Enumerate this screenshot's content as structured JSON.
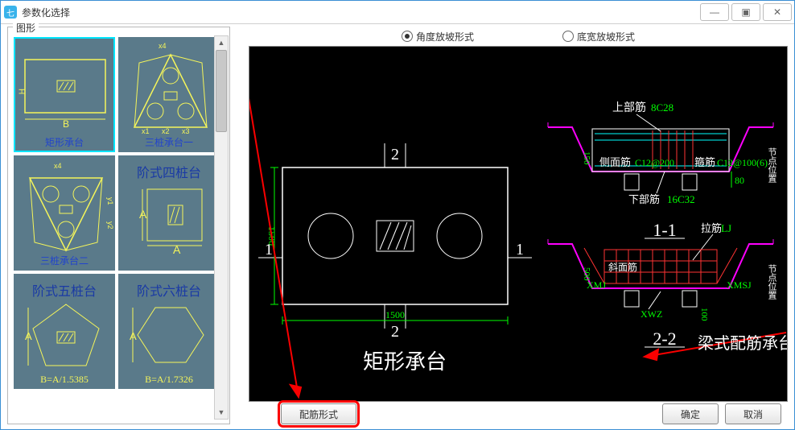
{
  "window": {
    "title": "参数化选择"
  },
  "sidebar": {
    "group_title": "图形",
    "items": [
      {
        "label": "矩形承台"
      },
      {
        "label": "三桩承台一"
      },
      {
        "label": "三桩承台二"
      },
      {
        "label": "阶式四桩台",
        "sub": "A"
      },
      {
        "label": "阶式五桩台",
        "sub": "B=A/1.5385"
      },
      {
        "label": "阶式六桩台",
        "sub": "B=A/1.7326"
      }
    ]
  },
  "options": {
    "radio_angle": "角度放坡形式",
    "radio_width": "底宽放坡形式"
  },
  "preview": {
    "left_title": "矩形承台",
    "right_title": "梁式配筋承台",
    "dim_top": "2",
    "dim_bottom": "2",
    "dim_left": "1",
    "dim_right": "1",
    "dim_h": "1500",
    "dim_v": "1500",
    "s11": "1-1",
    "s22": "2-2",
    "top_rebar": "上部筋",
    "top_rebar_v": "8C28",
    "side_rebar": "侧面筋",
    "side_rebar_v": "C12@200",
    "stirrup": "箍筋",
    "stirrup_v": "C12@100(6)",
    "bot_rebar": "下部筋",
    "bot_rebar_v": "16C32",
    "lj": "拉筋",
    "lj_v": "LJ",
    "xmj": "XMJ",
    "xmsj": "XMSJ",
    "xwz": "XWZ",
    "slope_rebar": "斜面筋",
    "d500": "500",
    "d80": "80",
    "d150": "150",
    "d100": "100",
    "jdwz": "节点位置",
    "jdwz2": "节点位置"
  },
  "buttons": {
    "rebar_form": "配筋形式",
    "ok": "确定",
    "cancel": "取消"
  }
}
